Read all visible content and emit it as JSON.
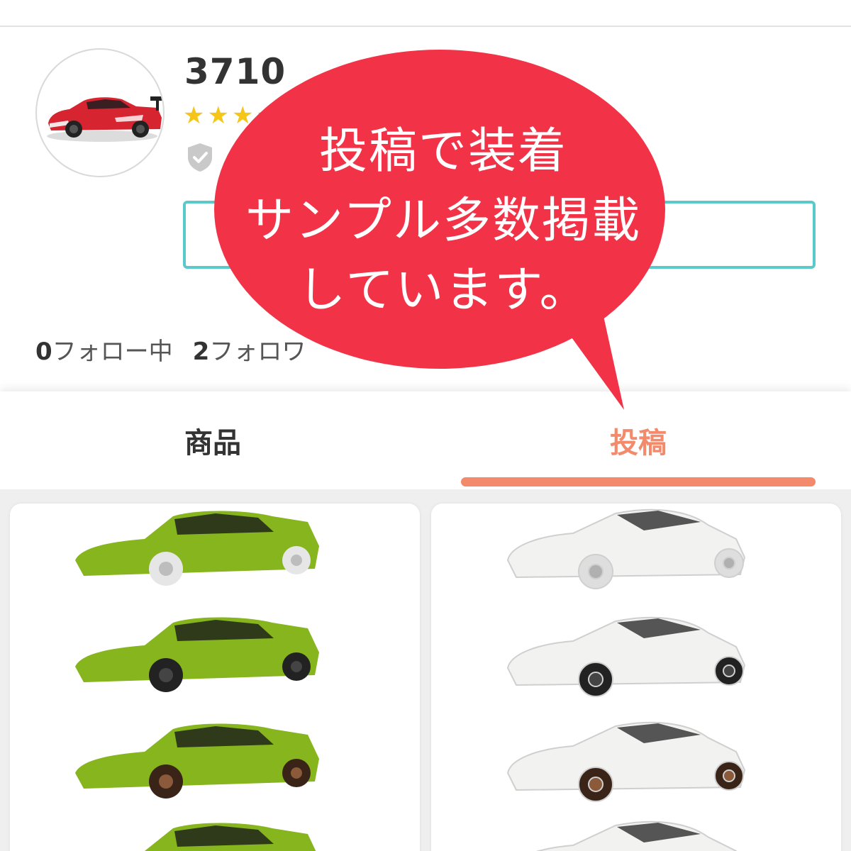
{
  "profile": {
    "username": "3710",
    "rating_stars": 5,
    "avatar_icon": "red-sports-car-icon",
    "verified_icon": "shield-check-icon"
  },
  "stats": {
    "following_count": "0",
    "following_label": "フォロー中",
    "followers_count": "2",
    "followers_label": "フォロワ"
  },
  "tabs": [
    {
      "label": "商品",
      "active": false
    },
    {
      "label": "投稿",
      "active": true
    }
  ],
  "overlay": {
    "lines": [
      "投稿で装着",
      "サンプル多数掲載",
      "しています。"
    ],
    "color": "#f23347"
  },
  "posts": [
    {
      "icon": "green-car-photo-icon",
      "car_color": "#86b51e"
    },
    {
      "icon": "white-car-photo-icon",
      "car_color": "#f2f2f0"
    }
  ],
  "colors": {
    "accent": "#f28a6b",
    "follow_border": "#5bc8cc",
    "star": "#f5c518"
  }
}
